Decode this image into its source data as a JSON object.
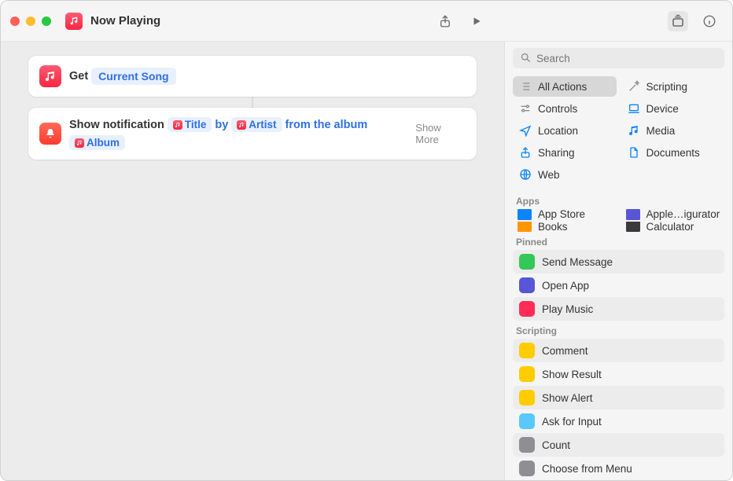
{
  "title": "Now Playing",
  "action1": {
    "verb": "Get",
    "token": "Current Song"
  },
  "action2": {
    "verb": "Show notification",
    "token_title": "Title",
    "by": "by",
    "token_artist": "Artist",
    "from": "from the album",
    "token_album": "Album",
    "show_more": "Show More"
  },
  "search_placeholder": "Search",
  "categories": [
    {
      "label": "All Actions",
      "color": "#8e8e93",
      "selected": true,
      "icon": "list"
    },
    {
      "label": "Scripting",
      "color": "#8e8e93",
      "icon": "wand"
    },
    {
      "label": "Controls",
      "color": "#8e8e93",
      "icon": "slider"
    },
    {
      "label": "Device",
      "color": "#0a84ff",
      "icon": "device"
    },
    {
      "label": "Location",
      "color": "#0a84ff",
      "icon": "nav"
    },
    {
      "label": "Media",
      "color": "#0a84ff",
      "icon": "note"
    },
    {
      "label": "Sharing",
      "color": "#0a84ff",
      "icon": "share"
    },
    {
      "label": "Documents",
      "color": "#0a84ff",
      "icon": "doc"
    },
    {
      "label": "Web",
      "color": "#0a84ff",
      "icon": "globe"
    }
  ],
  "apps_label": "Apps",
  "apps": [
    {
      "label": "App Store",
      "color": "#0a84ff"
    },
    {
      "label": "Apple…igurator",
      "color": "#5856d6"
    },
    {
      "label": "Books",
      "color": "#ff9500"
    },
    {
      "label": "Calculator",
      "color": "#3a3a3c"
    }
  ],
  "pinned_label": "Pinned",
  "pinned": [
    {
      "label": "Send Message",
      "color": "#34c759"
    },
    {
      "label": "Open App",
      "color": "#5856d6"
    },
    {
      "label": "Play Music",
      "color": "#ff2d55"
    }
  ],
  "scripting_label": "Scripting",
  "scripting": [
    {
      "label": "Comment",
      "color": "#ffcc00"
    },
    {
      "label": "Show Result",
      "color": "#ffcc00"
    },
    {
      "label": "Show Alert",
      "color": "#ffcc00"
    },
    {
      "label": "Ask for Input",
      "color": "#5ac8fa"
    },
    {
      "label": "Count",
      "color": "#8e8e93"
    },
    {
      "label": "Choose from Menu",
      "color": "#8e8e93"
    }
  ]
}
